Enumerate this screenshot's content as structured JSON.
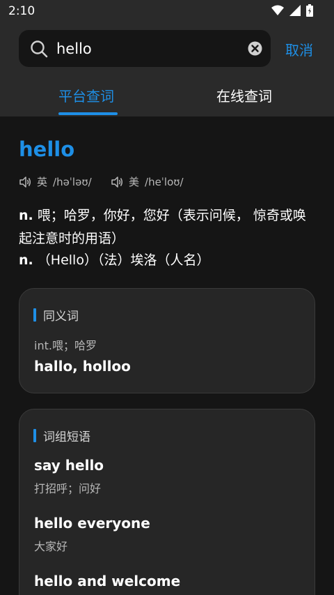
{
  "status_bar": {
    "time": "2:10",
    "icons": [
      "wifi-icon",
      "signal-icon",
      "battery-icon"
    ]
  },
  "search": {
    "value": "hello",
    "cancel_label": "取消"
  },
  "tabs": [
    {
      "label": "平台查词",
      "active": true
    },
    {
      "label": "在线查词",
      "active": false
    }
  ],
  "entry": {
    "word": "hello",
    "pronunciations": [
      {
        "region": "英",
        "ipa": "/həˈləʊ/"
      },
      {
        "region": "美",
        "ipa": "/heˈloʊ/"
      }
    ],
    "definitions": [
      {
        "pos": "n.",
        "text": " 喂；哈罗，你好，您好（表示问候， 惊奇或唤起注意时的用语）"
      },
      {
        "pos": "n.",
        "text": " （Hello）（法）埃洛（人名）"
      }
    ]
  },
  "synonyms": {
    "title": "同义词",
    "sub": "int.喂；哈罗",
    "words": "hallo, holloo"
  },
  "phrases": {
    "title": "词组短语",
    "items": [
      {
        "en": "say hello",
        "zh": "打招呼；问好"
      },
      {
        "en": "hello everyone",
        "zh": "大家好"
      },
      {
        "en": "hello and welcome",
        "zh": ""
      }
    ]
  },
  "colors": {
    "accent": "#1e8fe6",
    "background": "#151515",
    "header": "#2a2a2a",
    "card": "#262626"
  }
}
